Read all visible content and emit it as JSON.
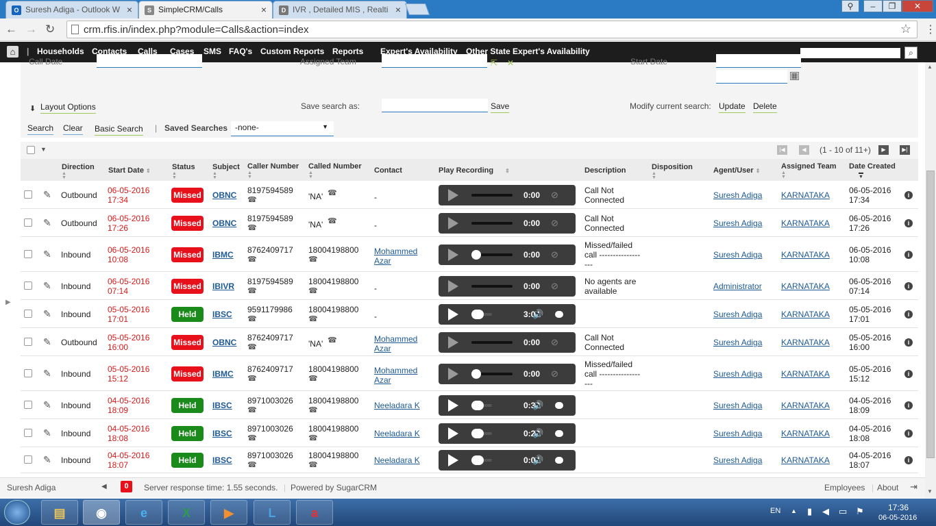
{
  "browser": {
    "tabs": [
      {
        "label": "Suresh Adiga - Outlook W",
        "fav": "O",
        "favcolor": "#1565c0"
      },
      {
        "label": "SimpleCRM/Calls",
        "fav": "S",
        "favcolor": "#888"
      },
      {
        "label": "IVR , Detailed MIS , Realti",
        "fav": "D",
        "favcolor": "#777"
      }
    ],
    "url": "crm.rfis.in/index.php?module=Calls&action=index"
  },
  "nav": {
    "items": [
      "Households",
      "Contacts",
      "Calls",
      "Cases",
      "SMS",
      "FAQ's",
      "Custom Reports",
      "Reports",
      "Expert's Availability",
      "Other State Expert's Availability"
    ],
    "active": "Calls"
  },
  "search_panel": {
    "call_date_label": "Call Date",
    "assigned_team_label": "Assigned Team",
    "start_date_label": "Start Date",
    "layout_options": "Layout Options",
    "save_search_as": "Save search as:",
    "save": "Save",
    "modify_current_search": "Modify current search:",
    "update": "Update",
    "delete": "Delete",
    "search": "Search",
    "clear": "Clear",
    "basic_search": "Basic Search",
    "saved_searches": "Saved Searches",
    "saved_searches_value": "-none-"
  },
  "pager": {
    "text": "(1 - 10 of 11+)"
  },
  "table": {
    "headers": [
      "Direction",
      "Start Date",
      "Status",
      "Subject",
      "Caller Number",
      "Called Number",
      "Contact",
      "Play Recording",
      "Description",
      "Disposition",
      "Agent/User",
      "Assigned Team",
      "Date Created"
    ],
    "rows": [
      {
        "direction": "Outbound",
        "start_date": "06-05-2016",
        "start_time": "17:34",
        "status": "Missed",
        "subject": "OBNC",
        "caller": "8197594589",
        "called": "'NA'",
        "contact": "-",
        "contact2": "",
        "time": "0:00",
        "desc1": "Call Not",
        "desc2": "Connected",
        "desc3": "",
        "agent": "Suresh Adiga",
        "team": "KARNATAKA",
        "created_date": "06-05-2016",
        "created_time": "17:34"
      },
      {
        "direction": "Outbound",
        "start_date": "06-05-2016",
        "start_time": "17:26",
        "status": "Missed",
        "subject": "OBNC",
        "caller": "8197594589",
        "called": "'NA'",
        "contact": "-",
        "contact2": "",
        "time": "0:00",
        "desc1": "Call Not",
        "desc2": "Connected",
        "desc3": "",
        "agent": "Suresh Adiga",
        "team": "KARNATAKA",
        "created_date": "06-05-2016",
        "created_time": "17:26"
      },
      {
        "direction": "Inbound",
        "start_date": "06-05-2016",
        "start_time": "10:08",
        "status": "Missed",
        "subject": "IBMC",
        "caller": "8762409717",
        "called": "18004198800",
        "contact": "Mohammed",
        "contact2": "Azar",
        "time": "0:00",
        "desc1": "Missed/failed",
        "desc2": "call ---------------",
        "desc3": "---",
        "agent": "Suresh Adiga",
        "team": "KARNATAKA",
        "created_date": "06-05-2016",
        "created_time": "10:08"
      },
      {
        "direction": "Inbound",
        "start_date": "06-05-2016",
        "start_time": "07:14",
        "status": "Missed",
        "subject": "IBIVR",
        "caller": "8197594589",
        "called": "18004198800",
        "contact": "-",
        "contact2": "",
        "time": "0:00",
        "desc1": "No agents are",
        "desc2": "available",
        "desc3": "",
        "agent": "Administrator",
        "team": "KARNATAKA",
        "created_date": "06-05-2016",
        "created_time": "07:14"
      },
      {
        "direction": "Inbound",
        "start_date": "05-05-2016",
        "start_time": "17:01",
        "status": "Held",
        "subject": "IBSC",
        "caller": "9591179986",
        "called": "18004198800",
        "contact": "-",
        "contact2": "",
        "time": "3:04",
        "desc1": "",
        "desc2": "",
        "desc3": "",
        "agent": "Suresh Adiga",
        "team": "KARNATAKA",
        "created_date": "05-05-2016",
        "created_time": "17:01"
      },
      {
        "direction": "Outbound",
        "start_date": "05-05-2016",
        "start_time": "16:00",
        "status": "Missed",
        "subject": "OBNC",
        "caller": "8762409717",
        "called": "'NA'",
        "contact": "Mohammed",
        "contact2": "Azar",
        "time": "0:00",
        "desc1": "Call Not",
        "desc2": "Connected",
        "desc3": "",
        "agent": "Suresh Adiga",
        "team": "KARNATAKA",
        "created_date": "05-05-2016",
        "created_time": "16:00"
      },
      {
        "direction": "Inbound",
        "start_date": "05-05-2016",
        "start_time": "15:12",
        "status": "Missed",
        "subject": "IBMC",
        "caller": "8762409717",
        "called": "18004198800",
        "contact": "Mohammed",
        "contact2": "Azar",
        "time": "0:00",
        "desc1": "Missed/failed",
        "desc2": "call ---------------",
        "desc3": "---",
        "agent": "Suresh Adiga",
        "team": "KARNATAKA",
        "created_date": "05-05-2016",
        "created_time": "15:12"
      },
      {
        "direction": "Inbound",
        "start_date": "04-05-2016",
        "start_time": "18:09",
        "status": "Held",
        "subject": "IBSC",
        "caller": "8971003026",
        "called": "18004198800",
        "contact": "Neeladara K",
        "contact2": "",
        "time": "0:39",
        "desc1": "",
        "desc2": "",
        "desc3": "",
        "agent": "Suresh Adiga",
        "team": "KARNATAKA",
        "created_date": "04-05-2016",
        "created_time": "18:09"
      },
      {
        "direction": "Inbound",
        "start_date": "04-05-2016",
        "start_time": "18:08",
        "status": "Held",
        "subject": "IBSC",
        "caller": "8971003026",
        "called": "18004198800",
        "contact": "Neeladara K",
        "contact2": "",
        "time": "0:22",
        "desc1": "",
        "desc2": "",
        "desc3": "",
        "agent": "Suresh Adiga",
        "team": "KARNATAKA",
        "created_date": "04-05-2016",
        "created_time": "18:08"
      },
      {
        "direction": "Inbound",
        "start_date": "04-05-2016",
        "start_time": "18:07",
        "status": "Held",
        "subject": "IBSC",
        "caller": "8971003026",
        "called": "18004198800",
        "contact": "Neeladara K",
        "contact2": "",
        "time": "0:04",
        "desc1": "",
        "desc2": "",
        "desc3": "",
        "agent": "Suresh Adiga",
        "team": "KARNATAKA",
        "created_date": "04-05-2016",
        "created_time": "18:07"
      }
    ]
  },
  "footer": {
    "user": "Suresh Adiga",
    "notifications": "0",
    "server_response": "Server response time: 1.55 seconds.",
    "powered_by": "Powered by SugarCRM",
    "employees": "Employees",
    "about": "About"
  },
  "taskbar": {
    "lang": "EN",
    "time": "17:36",
    "date": "06-05-2016"
  },
  "colors": {
    "missed": "#e8101a",
    "held": "#1a8a1a",
    "nav_bg": "#1d1d1d",
    "link": "#1d5a95"
  }
}
